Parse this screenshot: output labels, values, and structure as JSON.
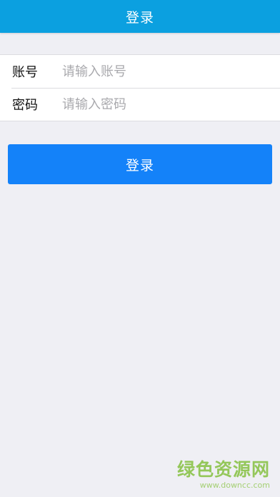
{
  "header": {
    "title": "登录"
  },
  "form": {
    "account": {
      "label": "账号",
      "placeholder": "请输入账号",
      "value": ""
    },
    "password": {
      "label": "密码",
      "placeholder": "请输入密码",
      "value": ""
    }
  },
  "actions": {
    "login_label": "登录"
  },
  "watermark": {
    "text": "绿色资源网",
    "url": "www.downcc.com"
  },
  "colors": {
    "header_bg": "#0ba0e0",
    "button_bg": "#1482f9",
    "page_bg": "#efeff4",
    "watermark": "#8bc34a"
  }
}
